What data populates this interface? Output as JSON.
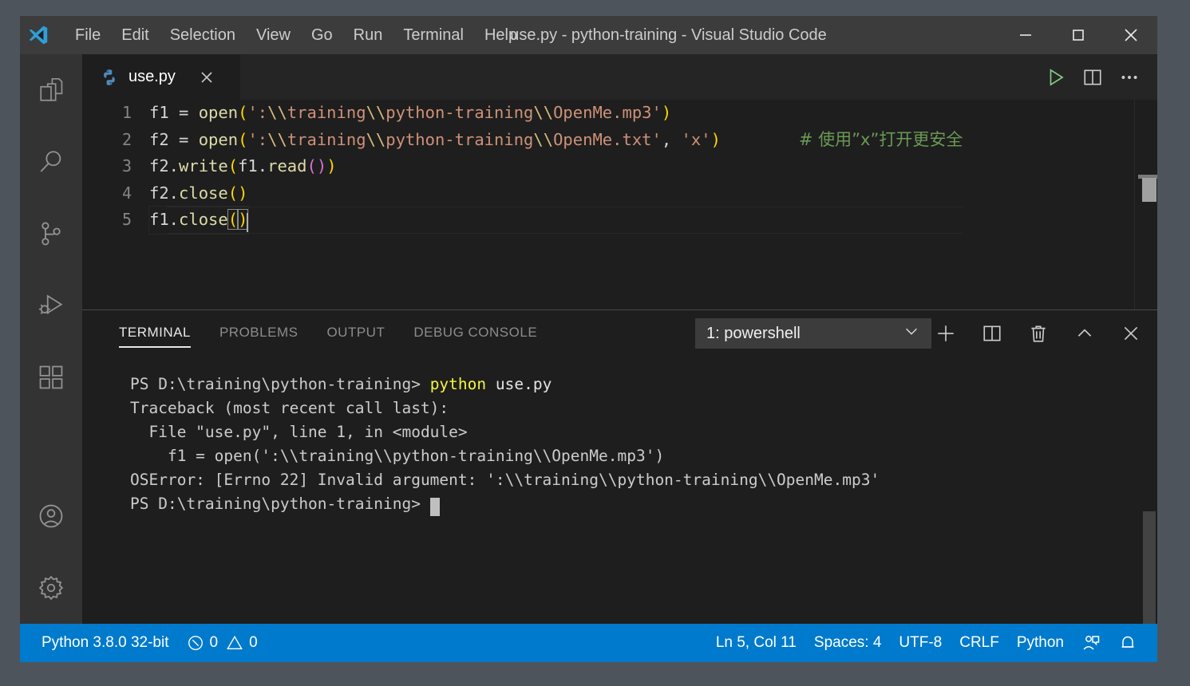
{
  "window": {
    "title": "use.py - python-training - Visual Studio Code",
    "minimize_label": "—",
    "maximize_label": "☐",
    "close_label": "✕"
  },
  "menu": {
    "items": [
      {
        "label": "File"
      },
      {
        "label": "Edit"
      },
      {
        "label": "Selection"
      },
      {
        "label": "View"
      },
      {
        "label": "Go"
      },
      {
        "label": "Run"
      },
      {
        "label": "Terminal"
      },
      {
        "label": "Help"
      }
    ]
  },
  "activity_bar": {
    "items": [
      {
        "name": "explorer-icon",
        "tooltip": "Explorer"
      },
      {
        "name": "search-icon",
        "tooltip": "Search"
      },
      {
        "name": "source-control-icon",
        "tooltip": "Source Control"
      },
      {
        "name": "run-and-debug-icon",
        "tooltip": "Run and Debug"
      },
      {
        "name": "extensions-icon",
        "tooltip": "Extensions"
      }
    ],
    "bottom_items": [
      {
        "name": "accounts-icon",
        "tooltip": "Accounts"
      },
      {
        "name": "settings-gear-icon",
        "tooltip": "Manage"
      }
    ]
  },
  "editor": {
    "tab": {
      "label": "use.py",
      "icon": "python-file-icon",
      "close_label": "✕"
    },
    "actions": [
      {
        "name": "run-python-file-button",
        "icon": "play-icon"
      },
      {
        "name": "split-editor-right-button",
        "icon": "split-editor-icon"
      },
      {
        "name": "more-actions-button",
        "icon": "ellipsis-icon"
      }
    ],
    "lines": [
      {
        "number": "1",
        "segments": [
          {
            "text": "f1 ",
            "cls": "ct"
          },
          {
            "text": "= ",
            "cls": "k-punc"
          },
          {
            "text": "open",
            "cls": "k-func"
          },
          {
            "text": "(",
            "cls": "k-paren1"
          },
          {
            "text": "':",
            "cls": "k-str"
          },
          {
            "text": "\\\\",
            "cls": "k-esc"
          },
          {
            "text": "training",
            "cls": "k-str"
          },
          {
            "text": "\\\\",
            "cls": "k-esc"
          },
          {
            "text": "python-training",
            "cls": "k-str"
          },
          {
            "text": "\\\\",
            "cls": "k-esc"
          },
          {
            "text": "OpenMe.mp3'",
            "cls": "k-str"
          },
          {
            "text": ")",
            "cls": "k-paren1"
          }
        ],
        "comment": ""
      },
      {
        "number": "2",
        "segments": [
          {
            "text": "f2 ",
            "cls": "ct"
          },
          {
            "text": "= ",
            "cls": "k-punc"
          },
          {
            "text": "open",
            "cls": "k-func"
          },
          {
            "text": "(",
            "cls": "k-paren1"
          },
          {
            "text": "':",
            "cls": "k-str"
          },
          {
            "text": "\\\\",
            "cls": "k-esc"
          },
          {
            "text": "training",
            "cls": "k-str"
          },
          {
            "text": "\\\\",
            "cls": "k-esc"
          },
          {
            "text": "python-training",
            "cls": "k-str"
          },
          {
            "text": "\\\\",
            "cls": "k-esc"
          },
          {
            "text": "OpenMe.txt'",
            "cls": "k-str"
          },
          {
            "text": ", ",
            "cls": "k-punc"
          },
          {
            "text": "'x'",
            "cls": "k-str"
          },
          {
            "text": ")",
            "cls": "k-paren1"
          }
        ],
        "comment": "# 使用”x”打开更安全"
      },
      {
        "number": "3",
        "segments": [
          {
            "text": "f2.",
            "cls": "ct"
          },
          {
            "text": "write",
            "cls": "k-func"
          },
          {
            "text": "(",
            "cls": "k-paren1"
          },
          {
            "text": "f1.",
            "cls": "ct"
          },
          {
            "text": "read",
            "cls": "k-func"
          },
          {
            "text": "(",
            "cls": "k-paren2"
          },
          {
            "text": ")",
            "cls": "k-paren2"
          },
          {
            "text": ")",
            "cls": "k-paren1"
          }
        ],
        "comment": ""
      },
      {
        "number": "4",
        "segments": [
          {
            "text": "f2.",
            "cls": "ct"
          },
          {
            "text": "close",
            "cls": "k-func"
          },
          {
            "text": "(",
            "cls": "k-paren1"
          },
          {
            "text": ")",
            "cls": "k-paren1"
          }
        ],
        "comment": ""
      },
      {
        "number": "5",
        "active": true,
        "segments": [
          {
            "text": "f1.",
            "cls": "ct"
          },
          {
            "text": "close",
            "cls": "k-func"
          },
          {
            "text": "(",
            "cls": "bracket-match"
          },
          {
            "text": ")",
            "cls": "bracket-match"
          }
        ],
        "comment": ""
      }
    ]
  },
  "panel": {
    "tabs": [
      {
        "label": "TERMINAL",
        "active": true
      },
      {
        "label": "PROBLEMS",
        "active": false
      },
      {
        "label": "OUTPUT",
        "active": false
      },
      {
        "label": "DEBUG CONSOLE",
        "active": false
      }
    ],
    "terminal_select": {
      "value": "1: powershell",
      "chevron": "⌄"
    },
    "actions": [
      {
        "name": "new-terminal-button",
        "icon": "plus-icon"
      },
      {
        "name": "split-terminal-button",
        "icon": "split-icon"
      },
      {
        "name": "kill-terminal-button",
        "icon": "trash-icon"
      },
      {
        "name": "maximize-panel-button",
        "icon": "chevron-up-icon"
      },
      {
        "name": "close-panel-button",
        "icon": "close-icon"
      }
    ],
    "terminal_lines": [
      {
        "segments": [
          {
            "text": "PS D:\\training\\python-training> ",
            "cls": ""
          },
          {
            "text": "python",
            "cls": "t-yellow"
          },
          {
            "text": " use.py",
            "cls": "t-white"
          }
        ]
      },
      {
        "segments": [
          {
            "text": "Traceback (most recent call last):",
            "cls": ""
          }
        ]
      },
      {
        "segments": [
          {
            "text": "  File \"use.py\", line 1, in <module>",
            "cls": ""
          }
        ]
      },
      {
        "segments": [
          {
            "text": "    f1 = open(':\\\\training\\\\python-training\\\\OpenMe.mp3')",
            "cls": ""
          }
        ]
      },
      {
        "segments": [
          {
            "text": "OSError: [Errno 22] Invalid argument: ':\\\\training\\\\python-training\\\\OpenMe.mp3'",
            "cls": ""
          }
        ]
      },
      {
        "segments": [
          {
            "text": "PS D:\\training\\python-training> ",
            "cls": ""
          }
        ],
        "cursor": true
      }
    ]
  },
  "status_bar": {
    "left": [
      {
        "name": "python-interpreter",
        "label": "Python 3.8.0 32-bit",
        "icon": ""
      },
      {
        "name": "errors-warnings",
        "label": "0",
        "label2": "0",
        "icon": "error-icon",
        "icon2": "warning-icon"
      }
    ],
    "right": [
      {
        "name": "cursor-position",
        "label": "Ln 5, Col 11"
      },
      {
        "name": "indentation",
        "label": "Spaces: 4"
      },
      {
        "name": "encoding",
        "label": "UTF-8"
      },
      {
        "name": "eol",
        "label": "CRLF"
      },
      {
        "name": "language-mode",
        "label": "Python"
      },
      {
        "name": "live-share",
        "label": "",
        "icon": "live-share-icon"
      },
      {
        "name": "notifications",
        "label": "",
        "icon": "bell-icon"
      }
    ]
  },
  "colors": {
    "accent": "#007acc",
    "titlebar_bg": "#3c3c3c",
    "activitybar_bg": "#333333",
    "editor_bg": "#1e1e1e",
    "tabbar_bg": "#252526",
    "desktop_bg": "#4d545c",
    "comment_green": "#6a9955",
    "string_orange": "#ce9178",
    "function_yellow": "#dcdcaa",
    "terminal_yellow": "#f5f543"
  }
}
